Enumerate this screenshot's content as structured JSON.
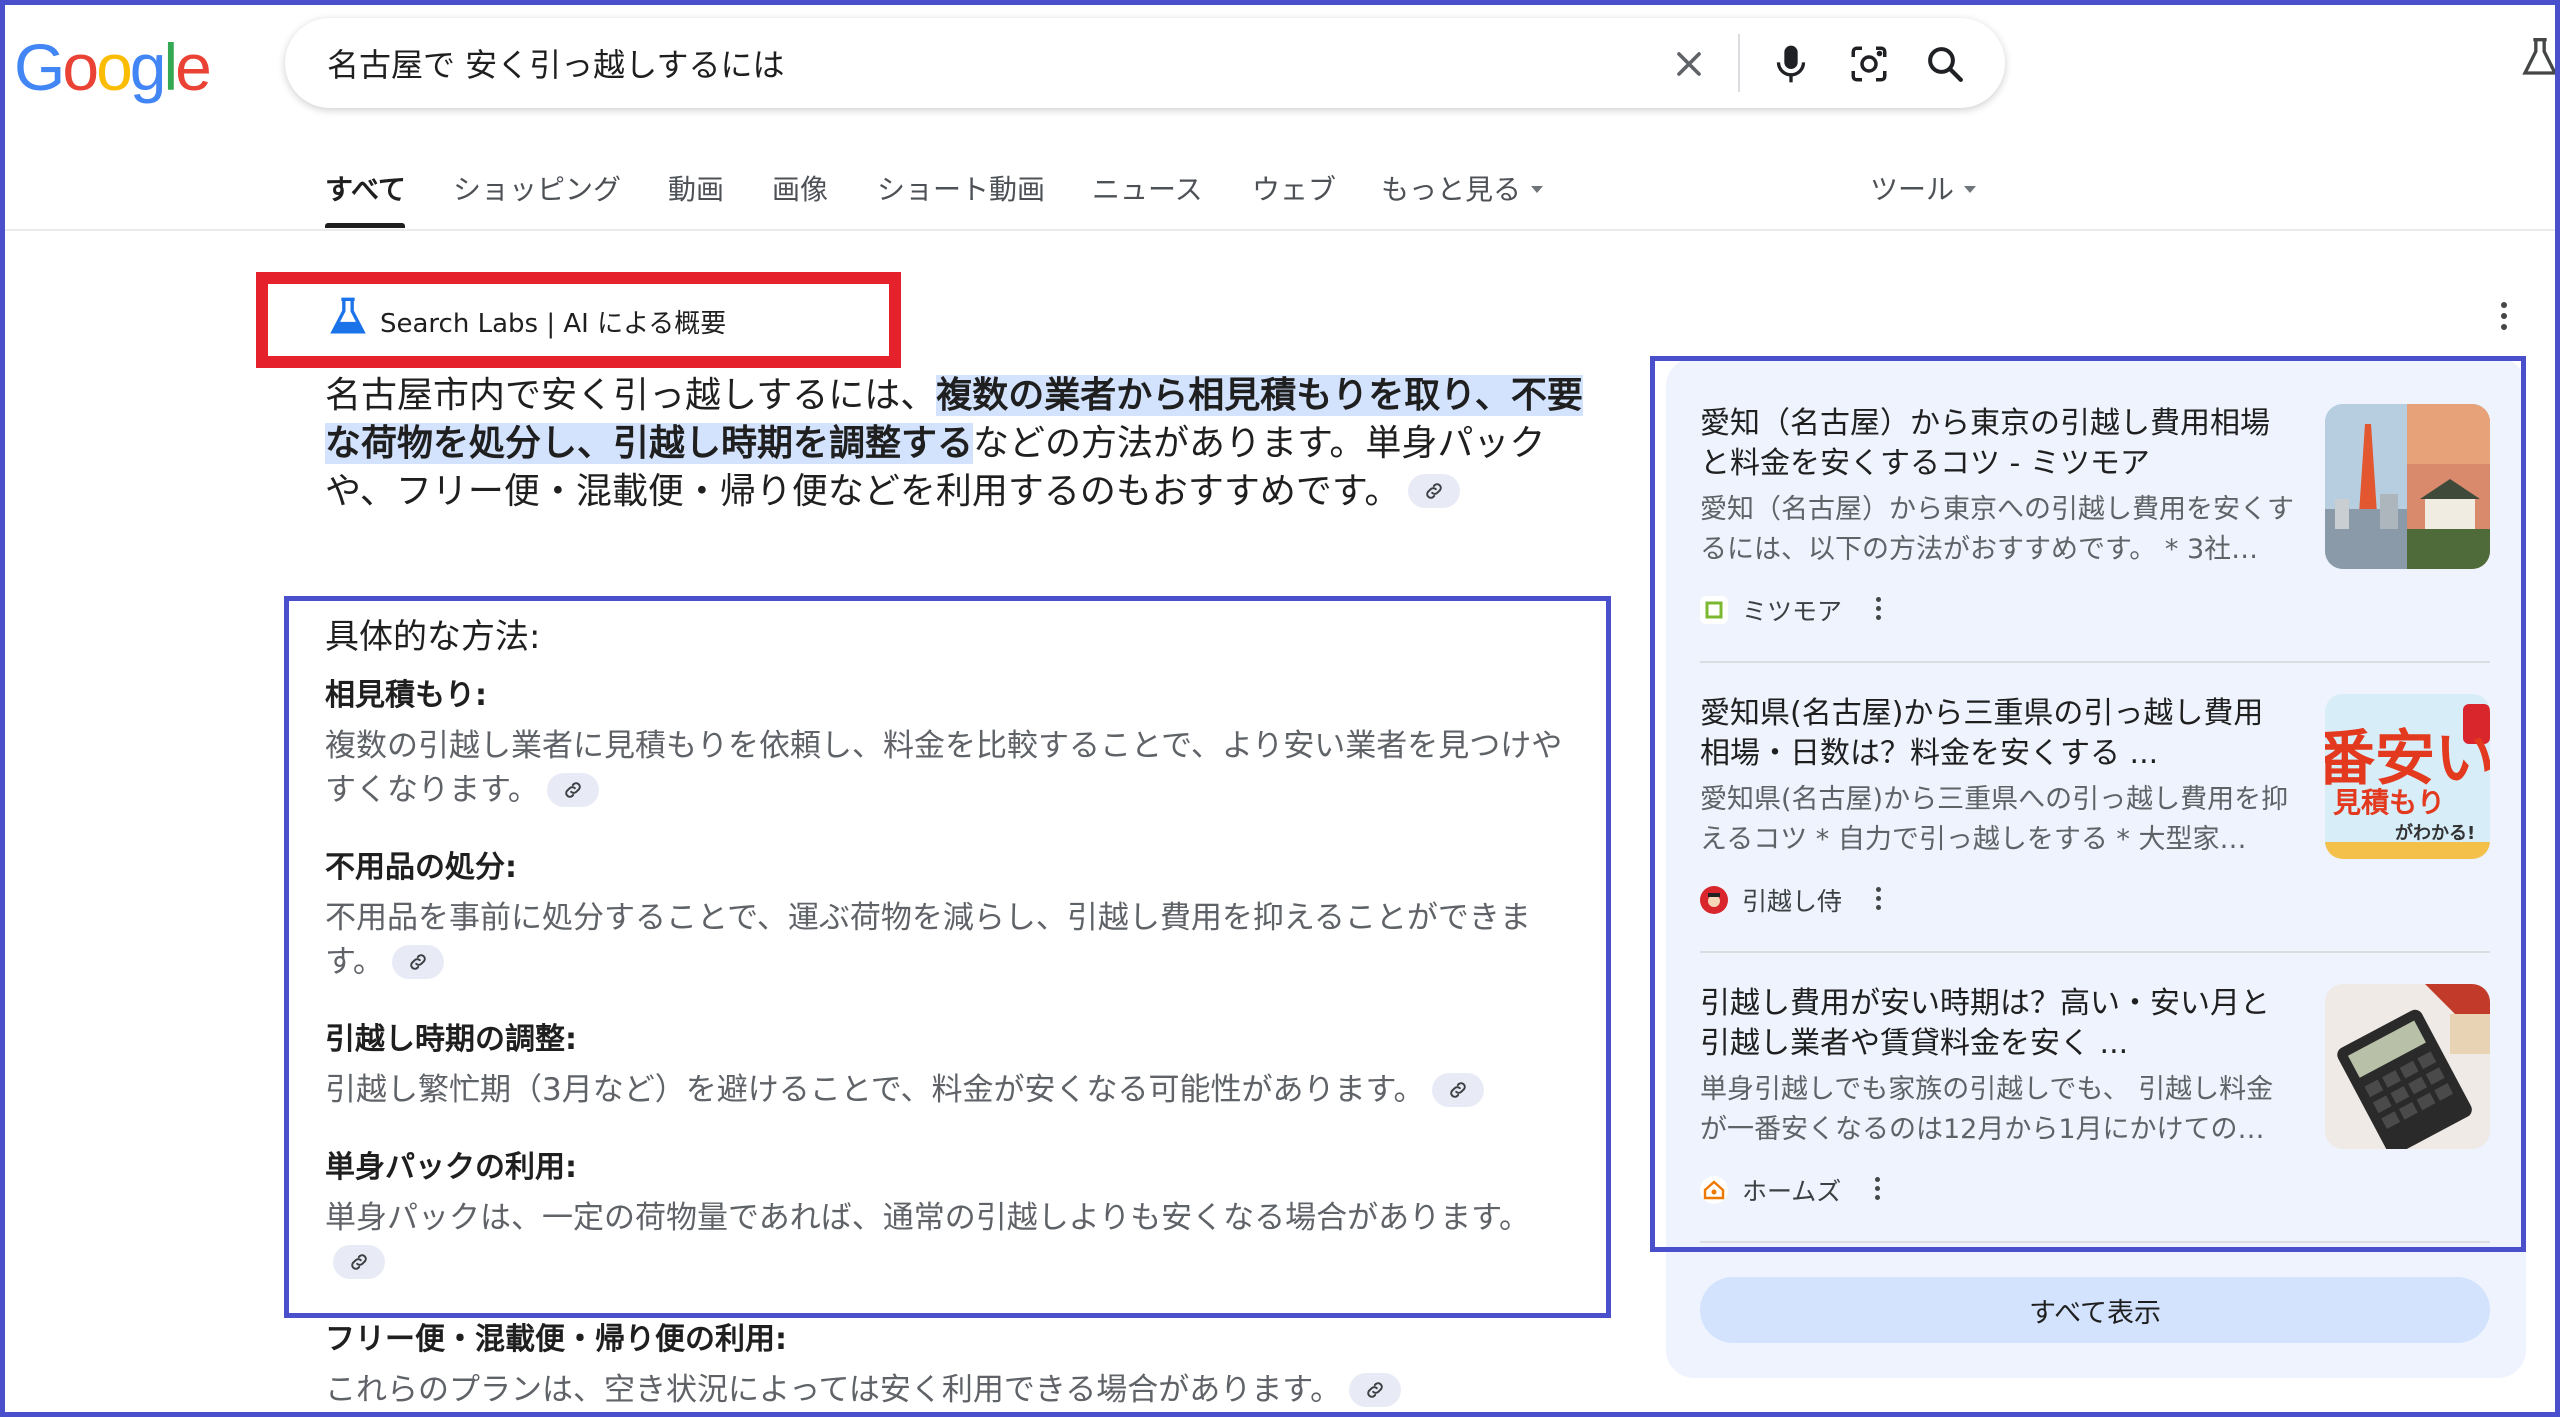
{
  "logo": {
    "letters": [
      "G",
      "o",
      "o",
      "g",
      "l",
      "e"
    ],
    "colors": [
      "#4285f4",
      "#ea4335",
      "#fbbc05",
      "#4285f4",
      "#34a853",
      "#ea4335"
    ]
  },
  "search": {
    "query": "名古屋で 安く引っ越しするには",
    "icons": [
      "close-icon",
      "mic-icon",
      "lens-icon",
      "search-icon"
    ]
  },
  "tabs": [
    {
      "label": "すべて"
    },
    {
      "label": "ショッピング"
    },
    {
      "label": "動画"
    },
    {
      "label": "画像"
    },
    {
      "label": "ショート動画"
    },
    {
      "label": "ニュース"
    },
    {
      "label": "ウェブ"
    },
    {
      "label": "もっと見る"
    },
    {
      "label": "ツール"
    }
  ],
  "ai_overview": {
    "title": "Search Labs | AI による概要",
    "summary": {
      "part1": "名古屋市内で安く引っ越しするには、",
      "highlight": "複数の業者から相見積もりを取り、不要な荷物を処分し、引越し時期を調整する",
      "part2": "などの方法があります。単身パックや、フリー便・混載便・帰り便などを利用するのもおすすめです。"
    },
    "methods_title": "具体的な方法:",
    "methods": [
      {
        "title": "相見積もり:",
        "desc": "複数の引越し業者に見積もりを依頼し、料金を比較することで、より安い業者を見つけやすくなります。"
      },
      {
        "title": "不用品の処分:",
        "desc": "不用品を事前に処分することで、運ぶ荷物を減らし、引越し費用を抑えることができます。"
      },
      {
        "title": "引越し時期の調整:",
        "desc": "引越し繁忙期（3月など）を避けることで、料金が安くなる可能性があります。"
      },
      {
        "title": "単身パックの利用:",
        "desc": "単身パックは、一定の荷物量であれば、通常の引越しよりも安くなる場合があります。"
      },
      {
        "title": "フリー便・混載便・帰り便の利用:",
        "desc": "これらのプランは、空き状況によっては安く利用できる場合があります。"
      }
    ]
  },
  "sources": [
    {
      "title": "愛知（名古屋）から東京の引越し費用相場と料金を安くするコツ - ミツモア",
      "desc": "愛知（名古屋）から東京への引越し費用を安くするには、以下の方法がおすすめです。 * 3社…",
      "site": "ミツモア"
    },
    {
      "title": "愛知県(名古屋)から三重県の引っ越し費用相場・日数は？料金を安くする ...",
      "desc": "愛知県(名古屋)から三重県への引っ越し費用を抑えるコツ * 自力で引っ越しをする * 大型家…",
      "site": "引越し侍",
      "thumb_text": [
        "番安い",
        "見積もり",
        "がわかる!"
      ]
    },
    {
      "title": "引越し費用が安い時期は？高い・安い月と引越し業者や賃貸料金を安く ...",
      "desc": "単身引越しでも家族の引越しでも、 引越し料金が一番安くなるのは12月から1月にかけての…",
      "site": "ホームズ"
    }
  ],
  "show_all_label": "すべて表示",
  "colors": {
    "accent": "#4a4fcc",
    "highlight_red": "#e5222b",
    "highlight_bg": "#d3e3fd",
    "panel_bg": "#eef3fd"
  }
}
